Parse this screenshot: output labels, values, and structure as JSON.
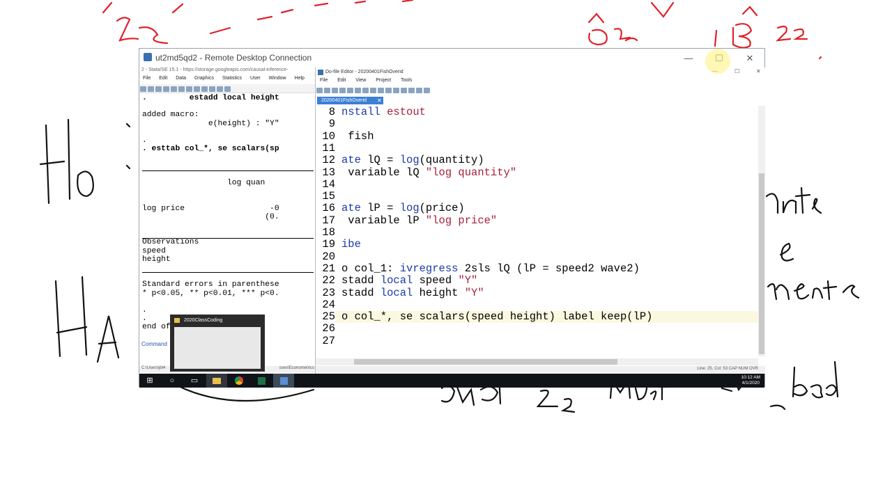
{
  "rdp": {
    "title": "ut2md5qd2 - Remote Desktop Connection",
    "minimize_glyph": "—",
    "maximize_glyph": "☐",
    "close_glyph": "✕"
  },
  "stata": {
    "title": "2 - Stata/SE 15.1 - https://storage.googleapis.com/causal-inference-",
    "menu": [
      "File",
      "Edit",
      "Data",
      "Graphics",
      "Statistics",
      "User",
      "Window",
      "Help"
    ],
    "results": [
      {
        "text": ".         estadd local height",
        "bold": true
      },
      {
        "text": "",
        "bold": false
      },
      {
        "text": "added macro:",
        "bold": false
      },
      {
        "text": "              e(height) : \"Y\"",
        "bold": false
      },
      {
        "text": "",
        "bold": false
      },
      {
        "text": ".",
        "bold": false
      },
      {
        "text": ". esttab col_*, se scalars(sp",
        "bold": true
      },
      {
        "text": "",
        "bold": false
      },
      {
        "text": "",
        "bold": false
      },
      {
        "text": "",
        "bold": false
      },
      {
        "text": "                  log quan",
        "bold": false
      },
      {
        "text": "",
        "bold": false
      },
      {
        "text": "",
        "bold": false
      },
      {
        "text": "log price                  -0",
        "bold": false
      },
      {
        "text": "                          (0.",
        "bold": false
      },
      {
        "text": "",
        "bold": false
      },
      {
        "text": "",
        "bold": false
      },
      {
        "text": "Observations",
        "bold": false
      },
      {
        "text": "speed",
        "bold": false
      },
      {
        "text": "height",
        "bold": false
      },
      {
        "text": "",
        "bold": false
      },
      {
        "text": "",
        "bold": false
      },
      {
        "text": "Standard errors in parenthese",
        "bold": false
      },
      {
        "text": "* p<0.05, ** p<0.01, *** p<0.",
        "bold": false
      },
      {
        "text": "",
        "bold": false
      },
      {
        "text": ".",
        "bold": false
      },
      {
        "text": ".",
        "bold": false
      },
      {
        "text": "end of do-file",
        "bold": false
      },
      {
        "text": "",
        "bold": false
      },
      {
        "text": ".",
        "bold": false
      }
    ],
    "command_label": "Command",
    "status_path": "C:\\Users\\jbl4",
    "status_path_right": "sses\\Econometrics"
  },
  "dofile": {
    "title": "Do-file Editor - 20200401FishOverid",
    "menu": [
      "File",
      "Edit",
      "View",
      "Project",
      "Tools"
    ],
    "tab": "20200401FishOverid",
    "tab_close": "✕",
    "status": "Line: 25, Col: 53   CAP   NUM   OVR",
    "lines": [
      {
        "n": "8",
        "parts": [
          {
            "t": "nstall ",
            "c": "kw"
          },
          {
            "t": "estout",
            "c": "str"
          }
        ]
      },
      {
        "n": "9",
        "parts": []
      },
      {
        "n": "10",
        "parts": [
          {
            "t": " fish",
            "c": ""
          }
        ]
      },
      {
        "n": "11",
        "parts": []
      },
      {
        "n": "12",
        "parts": [
          {
            "t": "ate",
            "c": "kw"
          },
          {
            "t": " lQ = ",
            "c": ""
          },
          {
            "t": "log",
            "c": "kw"
          },
          {
            "t": "(quantity)",
            "c": ""
          }
        ]
      },
      {
        "n": "13",
        "parts": [
          {
            "t": " variable lQ ",
            "c": ""
          },
          {
            "t": "\"log quantity\"",
            "c": "str"
          }
        ]
      },
      {
        "n": "14",
        "parts": []
      },
      {
        "n": "15",
        "parts": []
      },
      {
        "n": "16",
        "parts": [
          {
            "t": "ate",
            "c": "kw"
          },
          {
            "t": " lP = ",
            "c": ""
          },
          {
            "t": "log",
            "c": "kw"
          },
          {
            "t": "(price)",
            "c": ""
          }
        ]
      },
      {
        "n": "17",
        "parts": [
          {
            "t": " variable lP ",
            "c": ""
          },
          {
            "t": "\"log price\"",
            "c": "str"
          }
        ]
      },
      {
        "n": "18",
        "parts": []
      },
      {
        "n": "19",
        "parts": [
          {
            "t": "ibe",
            "c": "kw"
          }
        ]
      },
      {
        "n": "20",
        "parts": []
      },
      {
        "n": "21",
        "parts": [
          {
            "t": "o col_1: ",
            "c": ""
          },
          {
            "t": "ivregress",
            "c": "kw"
          },
          {
            "t": " 2sls lQ (lP = speed2 wave2)",
            "c": ""
          }
        ]
      },
      {
        "n": "22",
        "parts": [
          {
            "t": "stadd ",
            "c": ""
          },
          {
            "t": "local",
            "c": "kw"
          },
          {
            "t": " speed ",
            "c": ""
          },
          {
            "t": "\"Y\"",
            "c": "str"
          }
        ]
      },
      {
        "n": "23",
        "parts": [
          {
            "t": "stadd ",
            "c": ""
          },
          {
            "t": "local",
            "c": "kw"
          },
          {
            "t": " height ",
            "c": ""
          },
          {
            "t": "\"Y\"",
            "c": "str"
          }
        ]
      },
      {
        "n": "24",
        "parts": []
      },
      {
        "n": "25",
        "parts": [
          {
            "t": "o col_*, se scalars(speed height) label keep(lP)",
            "c": ""
          }
        ]
      },
      {
        "n": "26",
        "parts": []
      },
      {
        "n": "27",
        "parts": []
      }
    ]
  },
  "taskbar": {
    "thumbnail_title": "2020ClassCoding",
    "time": "10:12 AM",
    "date": "4/1/2020",
    "icons": [
      "windows-icon",
      "search-icon",
      "task-view-icon",
      "file-explorer-icon",
      "chrome-icon",
      "excel-icon",
      "remote-desktop-icon"
    ]
  },
  "colors": {
    "ink_red": "#e0202a",
    "ink_black": "#111111",
    "keyword_blue": "#1a3aa8",
    "string_red": "#a8203a",
    "tab_blue": "#3c7fd6"
  }
}
